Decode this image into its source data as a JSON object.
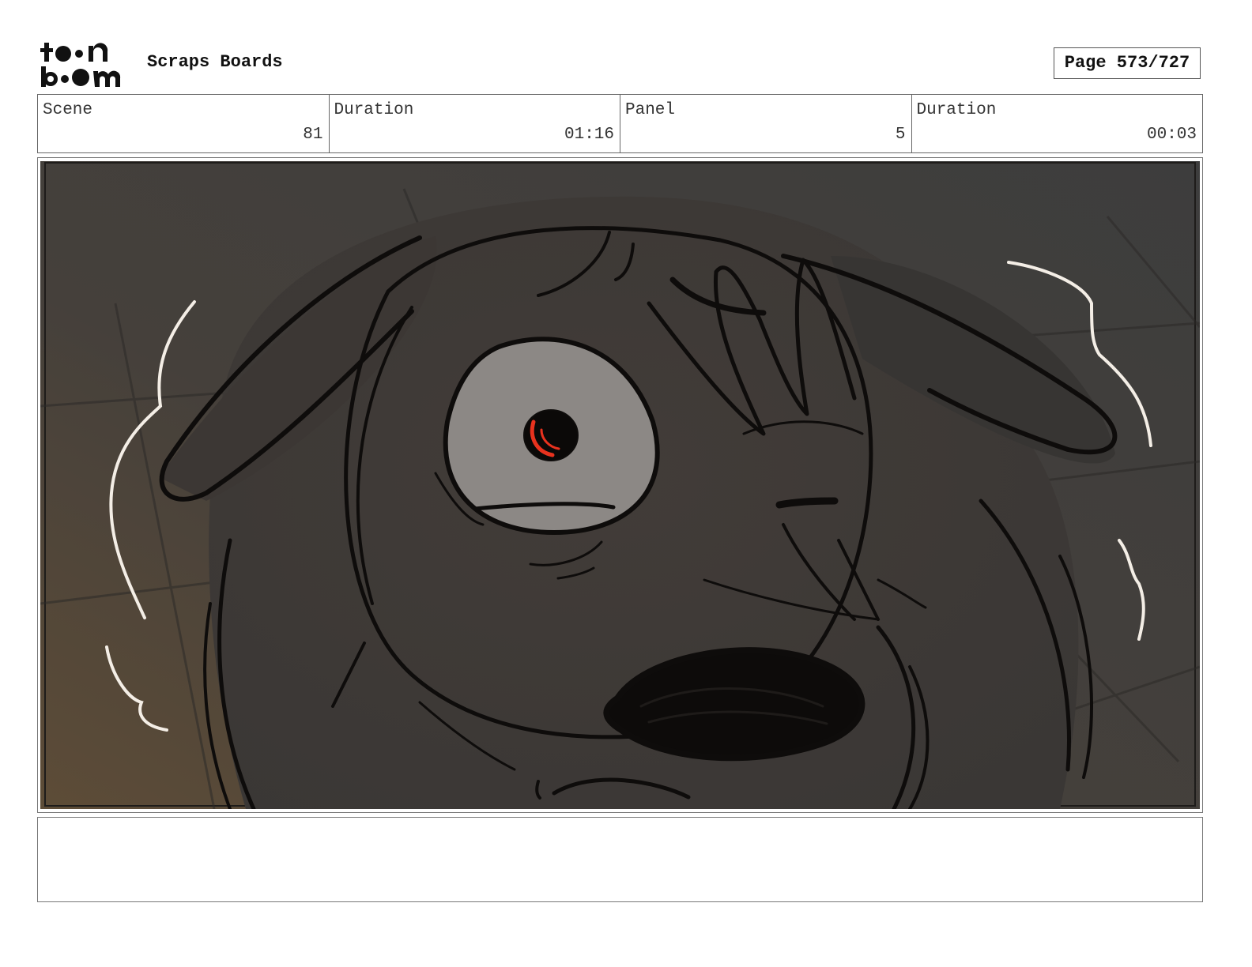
{
  "header": {
    "logo_text": "toonboom",
    "title": "Scraps Boards",
    "page_label": "Page 573/727"
  },
  "info": {
    "scene_label": "Scene",
    "scene_value": "81",
    "scene_duration_label": "Duration",
    "scene_duration_value": "01:16",
    "panel_label": "Panel",
    "panel_value": "5",
    "panel_duration_label": "Duration",
    "panel_duration_value": "00:03"
  },
  "panel": {
    "description": "",
    "colors": {
      "background_dark": "#3a3a3a",
      "background_warm": "#5a4a38",
      "character_fill": "#3e3a38",
      "eye_white": "#8c8885",
      "pupil_red": "#e8321e",
      "line": "#0e0c0b",
      "shake_lines": "#f4eee6"
    }
  },
  "notes": {
    "text": ""
  }
}
